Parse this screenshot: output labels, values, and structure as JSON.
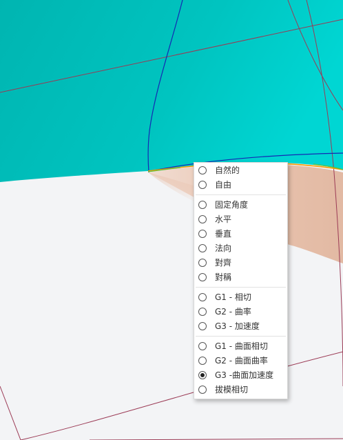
{
  "menu": {
    "groups": [
      [
        {
          "label": "自然的",
          "selected": false
        },
        {
          "label": "自由",
          "selected": false
        }
      ],
      [
        {
          "label": "固定角度",
          "selected": false
        },
        {
          "label": "水平",
          "selected": false
        },
        {
          "label": "垂直",
          "selected": false
        },
        {
          "label": "法向",
          "selected": false
        },
        {
          "label": "對齊",
          "selected": false
        },
        {
          "label": "對稱",
          "selected": false
        }
      ],
      [
        {
          "label": "G1 - 相切",
          "selected": false
        },
        {
          "label": "G2 - 曲率",
          "selected": false
        },
        {
          "label": "G3 - 加速度",
          "selected": false
        }
      ],
      [
        {
          "label": "G1 - 曲面相切",
          "selected": false
        },
        {
          "label": "G2 - 曲面曲率",
          "selected": false
        },
        {
          "label": "G3 -曲面加速度",
          "selected": true
        },
        {
          "label": "拔模相切",
          "selected": false
        }
      ]
    ]
  },
  "colors": {
    "surface_cyan": "#00bdb8",
    "surface_cyan_light": "#00d2cf",
    "background": "#f3f4f6",
    "peach_surface": "#e8c2ae",
    "wire_line": "#9b3a55",
    "blue_edge": "#1428b4",
    "highlight_edge": "#ff9a00"
  }
}
